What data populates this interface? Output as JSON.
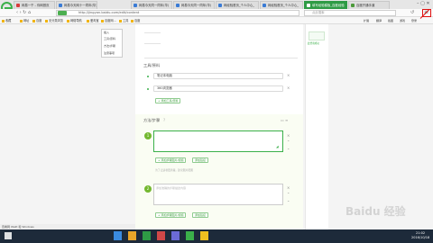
{
  "browser": {
    "tabs": [
      {
        "label": "网易一千 - 你网首页",
        "color": "#d83b3b"
      },
      {
        "label": "网易今天网十一同年(华)",
        "color": "#3a7bd5"
      },
      {
        "label": "网易今天同一同年(华)",
        "color": "#3a7bd5"
      },
      {
        "label": "网易今天同一同年(华)",
        "color": "#3a7bd5"
      },
      {
        "label": "网经验首页_个人中心_",
        "color": "#3a7bd5"
      },
      {
        "label": "网经验首页_个人中心_",
        "color": "#3a7bd5"
      },
      {
        "label": "填写经验模板_百度经验",
        "color": "#ffffff"
      },
      {
        "label": "百度开通手道",
        "color": "#4c9a3a"
      }
    ],
    "address": "http://jingyan.baidu.com/edit/content",
    "search_placeholder": "点此搜索",
    "bookmarks": [
      "收藏",
      "网址",
      "百度",
      "无分类浏览",
      "网络导航",
      "爱淘宝",
      "百度网...",
      "工具",
      "百度"
    ],
    "right_icons": [
      "扩展",
      "翻译",
      "截图",
      "游戏",
      "登录"
    ],
    "menu_items": [
      "插入",
      "工具/原料",
      "方法/步骤",
      "注意事项"
    ]
  },
  "editor": {
    "tools_title": "工具/原料",
    "tool_items": [
      "笔记本电脑",
      "360浏览器"
    ],
    "add_tool": "+ 添加工具/原料",
    "steps_title": "方法/步骤",
    "step_numbers": [
      "1",
      "2"
    ],
    "step2_placeholder": "添加准确的步骤描述内容",
    "add_image": "+ 添加步骤图片/视频",
    "add_link": "添加链接",
    "hint": "为了让读者更清楚，建议图片配图"
  },
  "side": {
    "label": "此经验成功"
  },
  "os": {
    "status": "查看网 Wallt 和 Windows",
    "time": "21:02",
    "date": "2016/10/18"
  },
  "watermark": "Baidu 经验",
  "accent": "#3bb04a"
}
